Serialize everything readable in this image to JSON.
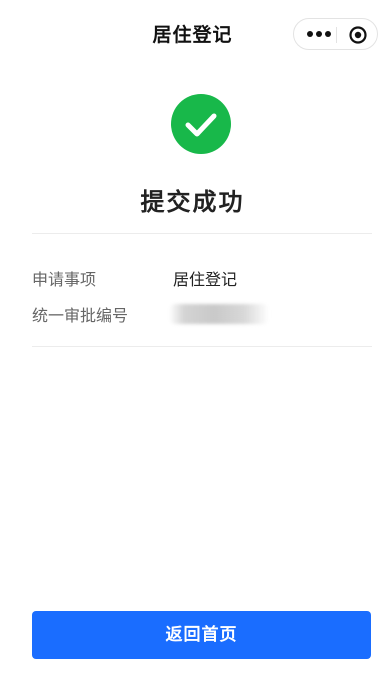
{
  "navbar": {
    "title": "居住登记",
    "more_icon": "more-dots-icon",
    "close_icon": "target-circle-icon"
  },
  "result": {
    "icon": "check-circle-icon",
    "icon_color": "#18b84a",
    "title": "提交成功"
  },
  "details": [
    {
      "label": "申请事项",
      "value": "居住登记"
    },
    {
      "label": "统一审批编号",
      "value": ""
    }
  ],
  "footer": {
    "button_label": "返回首页",
    "button_color": "#1a6dff"
  }
}
